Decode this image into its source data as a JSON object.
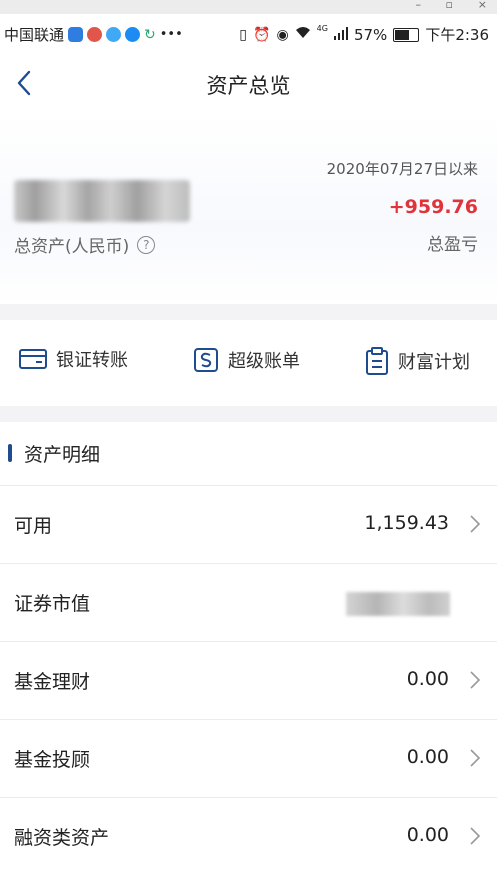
{
  "window_controls": {
    "minimize": "–",
    "maximize": "▫",
    "close": "×"
  },
  "status_bar": {
    "carrier": "中国联通",
    "battery": "57%",
    "network": "4G",
    "time": "下午2:36"
  },
  "header": {
    "title": "资产总览"
  },
  "summary": {
    "total_label": "总资产(人民币)",
    "help_symbol": "?",
    "since_label": "2020年07月27日以来",
    "profit_value": "+959.76",
    "profit_label": "总盈亏",
    "profit_color": "#e0343b"
  },
  "actions": [
    {
      "label": "银证转账",
      "icon": "card-icon"
    },
    {
      "label": "超级账单",
      "icon": "bill-icon"
    },
    {
      "label": "财富计划",
      "icon": "clipboard-icon"
    }
  ],
  "details": {
    "title": "资产明细",
    "accent": "#1f4b8f",
    "rows": [
      {
        "label": "可用",
        "value": "1,159.43"
      },
      {
        "label": "证券市值",
        "value": ""
      },
      {
        "label": "基金理财",
        "value": "0.00"
      },
      {
        "label": "基金投顾",
        "value": "0.00"
      },
      {
        "label": "融资类资产",
        "value": "0.00"
      }
    ]
  }
}
